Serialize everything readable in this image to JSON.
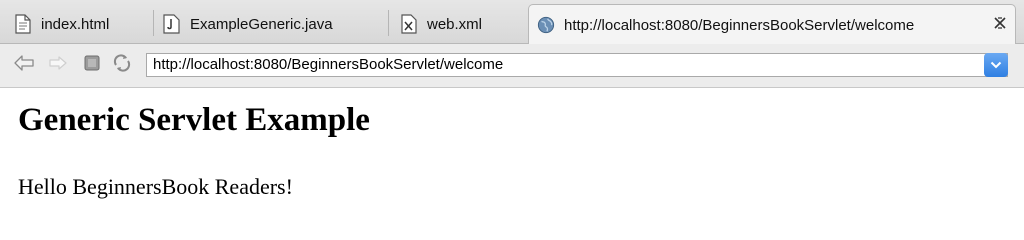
{
  "tabs": [
    {
      "label": "index.html",
      "icon": "html-file-icon"
    },
    {
      "label": "ExampleGeneric.java",
      "icon": "java-file-icon"
    },
    {
      "label": "web.xml",
      "icon": "xml-file-icon"
    },
    {
      "label": "http://localhost:8080/BeginnersBookServlet/welcome",
      "icon": "globe-icon",
      "active": true
    }
  ],
  "toolbar": {
    "url": "http://localhost:8080/BeginnersBookServlet/welcome"
  },
  "page": {
    "heading": "Generic Servlet Example",
    "message": "Hello BeginnersBook Readers!"
  },
  "colors": {
    "dropdown_accent": "#2f7fe2"
  }
}
